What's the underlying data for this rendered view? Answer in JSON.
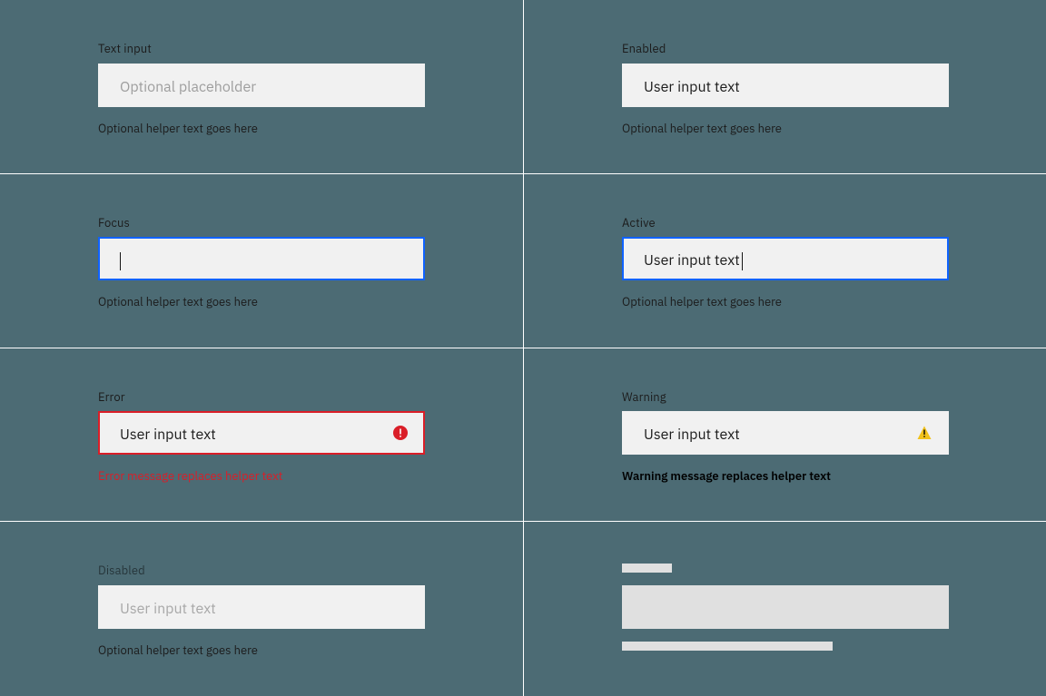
{
  "colors": {
    "focus_border": "#0f62fe",
    "error": "#da1e28",
    "warning_icon": "#f1c21b",
    "warning_bang": "#000000",
    "field_bg": "#f1f1f1",
    "skeleton": "#e0e0e0",
    "placeholder_text": "#9e9e9e",
    "page_bg": "#4c6b74"
  },
  "fields": {
    "text_input": {
      "label": "Text input",
      "placeholder": "Optional placeholder",
      "helper": "Optional helper text goes here"
    },
    "enabled": {
      "label": "Enabled",
      "value": "User input text",
      "helper": "Optional helper text goes here"
    },
    "focus": {
      "label": "Focus",
      "value": "",
      "helper": "Optional helper text goes here"
    },
    "active": {
      "label": "Active",
      "value": "User input text",
      "helper": "Optional helper text goes here"
    },
    "error": {
      "label": "Error",
      "value": "User input text",
      "error_message": "Error message replaces helper text"
    },
    "warning": {
      "label": "Warning",
      "value": "User input text",
      "warning_message": "Warning message replaces helper text"
    },
    "disabled": {
      "label": "Disabled",
      "value": "User input text",
      "helper": "Optional helper text goes here"
    }
  }
}
